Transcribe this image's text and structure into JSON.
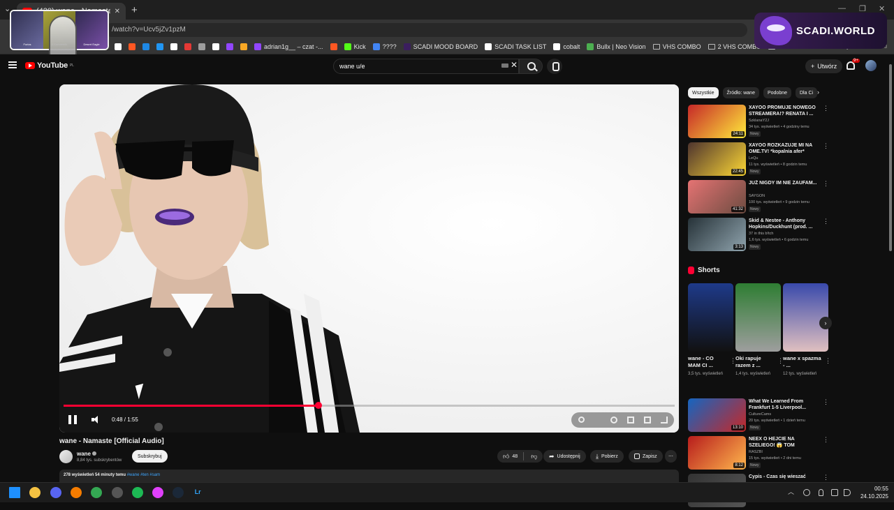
{
  "browser": {
    "tab_title": "(420) wane - Namaste [Official A",
    "url": "/watch?v=Ucv5jZv1pzM",
    "bookmarks": [
      {
        "label": "",
        "color": "#ffffff"
      },
      {
        "label": "",
        "color": "#ff5722"
      },
      {
        "label": "",
        "color": "#1e88e5"
      },
      {
        "label": "",
        "color": "#2196f3"
      },
      {
        "label": "",
        "color": "#ffffff"
      },
      {
        "label": "",
        "color": "#e53935"
      },
      {
        "label": "",
        "color": "#9e9e9e"
      },
      {
        "label": "",
        "color": "#ffffff"
      },
      {
        "label": "",
        "color": "#9146ff"
      },
      {
        "label": "",
        "color": "#f9a825"
      },
      {
        "label": "adrian1g__ – czat -...",
        "color": "#9146ff"
      },
      {
        "label": "",
        "color": "#ff5722"
      },
      {
        "label": "Kick",
        "color": "#53fc18"
      },
      {
        "label": "????",
        "color": "#4285f4"
      },
      {
        "label": "SCADI MOOD BOARD",
        "color": "#3b1e5e"
      },
      {
        "label": "SCADI TASK LIST",
        "color": "#ffffff"
      },
      {
        "label": "cobalt",
        "color": "#ffffff"
      },
      {
        "label": "Bullx | Neo Vision",
        "color": "#4caf50"
      },
      {
        "label": "VHS COMBO",
        "folder": true
      },
      {
        "label": "2 VHS COMBO",
        "folder": true
      },
      {
        "label": "HONDA",
        "folder": true
      }
    ],
    "all_bookmarks": "Wszystkie zakładki",
    "scadi_label": "SCADI.WORLD",
    "overlay_labels": [
      "Furios",
      "A Kamaemik",
      "Desert Eagle"
    ]
  },
  "youtube": {
    "logo": "YouTube",
    "logo_country": "PL",
    "search_value": "wane u/e",
    "create_label": "Utwórz",
    "notifications_badge": "9+"
  },
  "video": {
    "title": "wane - Namaste [Official Audio]",
    "time_display": "0:48 / 1:55",
    "progress_fraction": 0.417,
    "channel_name": "wane",
    "channel_subs": "8,84 tys. subskrybentów",
    "subscribe_label": "Subskrybuj",
    "likes": "48",
    "share_label": "Udostępnij",
    "download_label": "Pobierz",
    "save_label": "Zapisz",
    "views": "278 wyświetleń",
    "time_ago": "54 minuty temu",
    "tags": "#wane #ten #sam"
  },
  "sidebar": {
    "chips": [
      "Wszystkie",
      "Źródło: wane",
      "Podobne",
      "Dla Ci"
    ],
    "recommendations": [
      {
        "title": "XAYOO PROMUJE NOWEGO STREAMERA!? RENATA I ...",
        "channel": "SzklanaY2J",
        "meta": "34 tys. wyświetleń • 4 godziny temu",
        "badge": "Nowy",
        "duration": "24:11",
        "thumb": [
          "#c62828",
          "#ffeb3b"
        ]
      },
      {
        "title": "XAYOO ROZKAZUJE MI NA OME.TV! *kopalnia afer*",
        "channel": "LeQu",
        "meta": "11 tys. wyświetleń • 8 godzin temu",
        "badge": "Nowy",
        "duration": "22:45",
        "thumb": [
          "#4e342e",
          "#fdd835"
        ]
      },
      {
        "title": "JUŻ NIGDY IM NIE ZAUFAM...",
        "channel": "SAYGON",
        "meta": "100 tys. wyświetleń • 9 godzin temu",
        "badge": "Nowy",
        "duration": "41:32",
        "thumb": [
          "#e57373",
          "#6d4c41"
        ]
      },
      {
        "title": "Skid & Nestee - Anthony Hopkins/Duckhunt (prod. ...",
        "channel": "37 in this b!tch",
        "meta": "1,6 tys. wyświetleń • 6 godzin temu",
        "badge": "Nowy",
        "duration": "3:13",
        "thumb": [
          "#263238",
          "#90a4ae"
        ]
      }
    ],
    "shorts_label": "Shorts",
    "shorts": [
      {
        "title": "wane - CO MAM CI ...",
        "views": "3,5 tys. wyświetleń",
        "thumb": [
          "#1e3a8a",
          "#111111"
        ]
      },
      {
        "title": "Oki rapuje razem z ...",
        "views": "1,4 tys. wyświetleń",
        "thumb": [
          "#2e7d32",
          "#9e9e9e"
        ]
      },
      {
        "title": "wane x spazma - ...",
        "views": "12 tys. wyświetleń",
        "thumb": [
          "#3949ab",
          "#e0c0c0"
        ]
      }
    ],
    "recommendations_lower": [
      {
        "title": "What We Learned From Frankfurt 1-5 Liverpool...",
        "channel": "CultureCams",
        "meta": "20 tys. wyświetleń • 1 dzień temu",
        "badge": "Nowy",
        "duration": "13:10",
        "thumb": [
          "#1565c0",
          "#c62828"
        ]
      },
      {
        "title": "NEEX O HEJCIE NA SZELIEGO! 😱 TOM TROLLUJE SNAXA N...",
        "channel": "RASZBI",
        "meta": "15 tys. wyświetleń • 2 dni temu",
        "badge": "Nowy",
        "duration": "8:12",
        "thumb": [
          "#b71c1c",
          "#ffb74d"
        ]
      },
      {
        "title": "Cypis - Czas się wieszać",
        "channel": "",
        "meta": "",
        "badge": "",
        "duration": "",
        "thumb": [
          "#333333",
          "#555555"
        ]
      }
    ]
  },
  "taskbar": {
    "time": "00:55",
    "date": "24.10.2025",
    "apps": [
      {
        "name": "windows",
        "color": "#1e90ff"
      },
      {
        "name": "explorer",
        "color": "#f5c242"
      },
      {
        "name": "discord",
        "color": "#5865f2"
      },
      {
        "name": "app-orange",
        "color": "#f57c00"
      },
      {
        "name": "chrome",
        "color": "#34a853"
      },
      {
        "name": "obs",
        "color": "#555555"
      },
      {
        "name": "spotify",
        "color": "#1db954"
      },
      {
        "name": "app-pink",
        "color": "#e040fb"
      },
      {
        "name": "steam",
        "color": "#1b2838"
      },
      {
        "name": "lightroom",
        "color": "#001e36",
        "label": "Lr"
      }
    ]
  }
}
